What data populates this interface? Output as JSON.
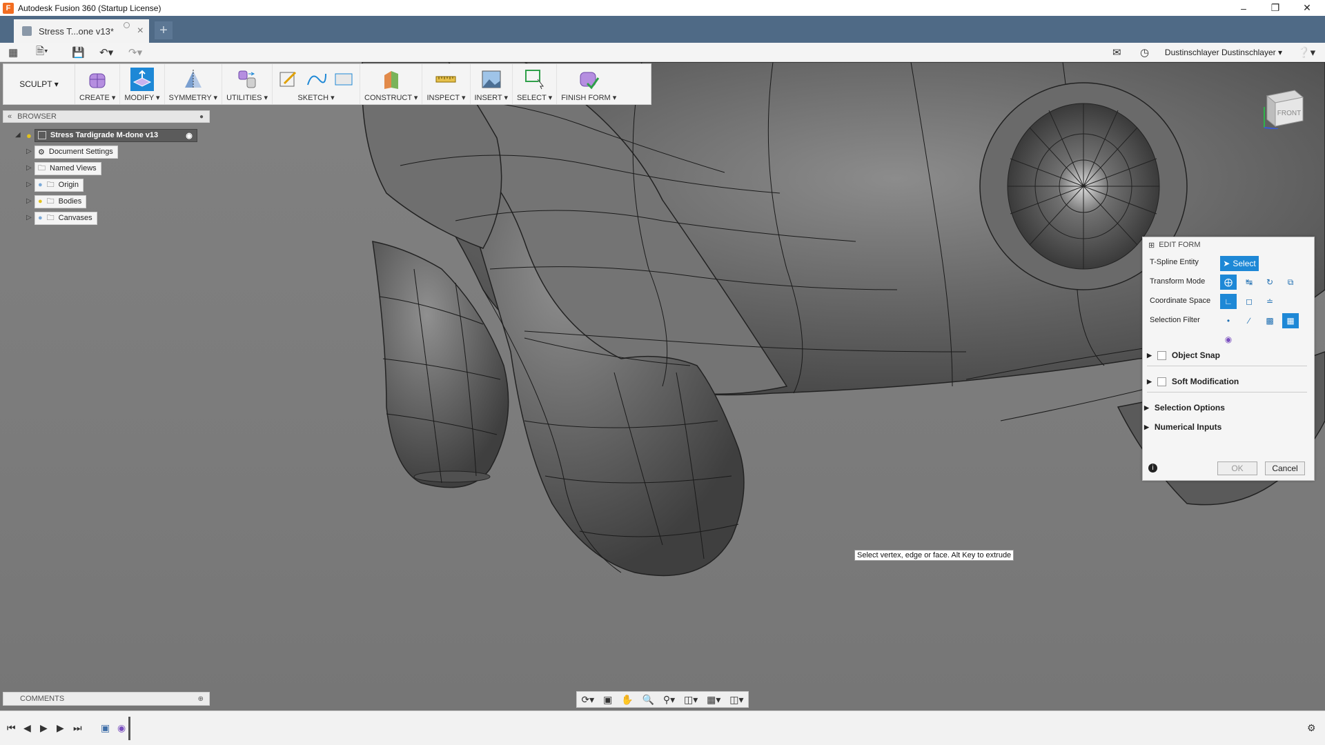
{
  "window": {
    "title": "Autodesk Fusion 360 (Startup License)",
    "app_icon": "F",
    "controls": [
      "minimize-icon",
      "restore-icon",
      "close-icon"
    ]
  },
  "tabs": [
    {
      "label": "Stress T...one v13*",
      "active": true
    }
  ],
  "quick_access": {
    "user_name": "Dustinschlayer Dustinschlayer ▾",
    "icons": [
      "grid-icon",
      "file-icon",
      "save-icon",
      "undo-icon",
      "redo-icon",
      "notification-icon",
      "clock-icon",
      "help-icon"
    ]
  },
  "ribbon": {
    "workspace": "SCULPT ▾",
    "groups": [
      {
        "label": "CREATE ▾",
        "icon": "box-icon"
      },
      {
        "label": "MODIFY ▾",
        "icon": "edit-form-icon"
      },
      {
        "label": "SYMMETRY ▾",
        "icon": "symmetry-icon"
      },
      {
        "label": "UTILITIES ▾",
        "icon": "utilities-icon"
      },
      {
        "label": "SKETCH ▾",
        "icon": "sketch-icon"
      },
      {
        "label": "CONSTRUCT ▾",
        "icon": "plane-icon"
      },
      {
        "label": "INSPECT ▾",
        "icon": "ruler-icon"
      },
      {
        "label": "INSERT ▾",
        "icon": "image-icon"
      },
      {
        "label": "SELECT ▾",
        "icon": "select-icon"
      },
      {
        "label": "FINISH FORM ▾",
        "icon": "finish-form-icon"
      }
    ]
  },
  "browser": {
    "title": "BROWSER",
    "root": "Stress Tardigrade M-done v13",
    "items": [
      "Document Settings",
      "Named Views",
      "Origin",
      "Bodies",
      "Canvases"
    ]
  },
  "comments": {
    "title": "COMMENTS"
  },
  "viewcube": {
    "face": "FRONT"
  },
  "edit_form": {
    "title": "EDIT FORM",
    "tspline_label": "T-Spline Entity",
    "select_label": "Select",
    "transform_label": "Transform Mode",
    "coordinate_label": "Coordinate Space",
    "filter_label": "Selection Filter",
    "object_snap": "Object Snap",
    "soft_mod": "Soft Modification",
    "selection_options": "Selection Options",
    "numerical_inputs": "Numerical Inputs",
    "ok": "OK",
    "cancel": "Cancel"
  },
  "hint": "Select vertex, edge or face. Alt Key to extrude",
  "colors": {
    "accent": "#1e88d6",
    "tabstrip": "#4f6a86",
    "model": "#6b6b6b"
  }
}
